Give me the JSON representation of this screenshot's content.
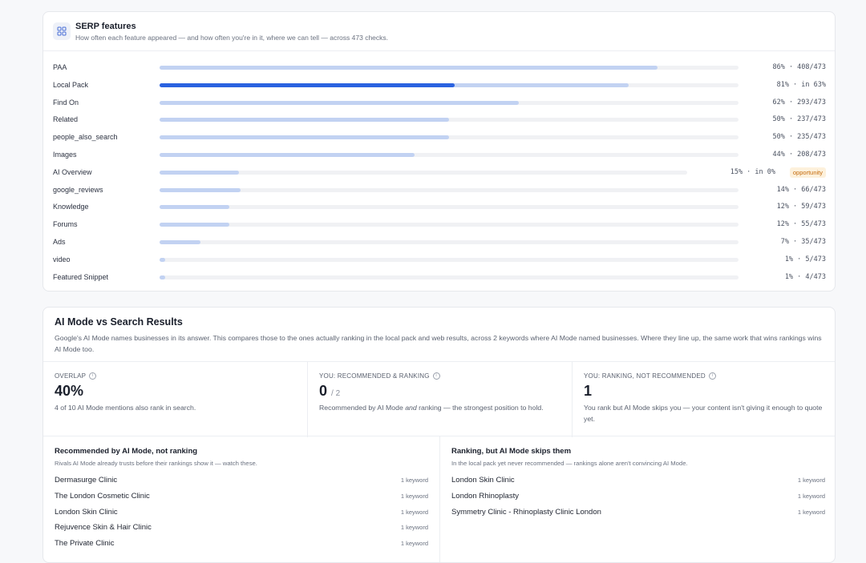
{
  "serp": {
    "title": "SERP features",
    "subtitle": "How often each feature appeared — and how often you're in it, where we can tell — across 473 checks.",
    "icon": "grid-icon",
    "rows": [
      {
        "label": "PAA",
        "pct": 86,
        "you_pct": null,
        "stat": "86% · 408/473",
        "badge": null
      },
      {
        "label": "Local Pack",
        "pct": 81,
        "you_pct": 63,
        "stat": "81% · in 63%",
        "badge": null
      },
      {
        "label": "Find On",
        "pct": 62,
        "you_pct": null,
        "stat": "62% · 293/473",
        "badge": null
      },
      {
        "label": "Related",
        "pct": 50,
        "you_pct": null,
        "stat": "50% · 237/473",
        "badge": null
      },
      {
        "label": "people_also_search",
        "pct": 50,
        "you_pct": null,
        "stat": "50% · 235/473",
        "badge": null
      },
      {
        "label": "Images",
        "pct": 44,
        "you_pct": null,
        "stat": "44% · 208/473",
        "badge": null
      },
      {
        "label": "AI Overview",
        "pct": 15,
        "you_pct": 0,
        "stat": "15% · in 0%",
        "badge": "opportunity"
      },
      {
        "label": "google_reviews",
        "pct": 14,
        "you_pct": null,
        "stat": "14% · 66/473",
        "badge": null
      },
      {
        "label": "Knowledge",
        "pct": 12,
        "you_pct": null,
        "stat": "12% · 59/473",
        "badge": null
      },
      {
        "label": "Forums",
        "pct": 12,
        "you_pct": null,
        "stat": "12% · 55/473",
        "badge": null
      },
      {
        "label": "Ads",
        "pct": 7,
        "you_pct": null,
        "stat": "7% · 35/473",
        "badge": null
      },
      {
        "label": "video",
        "pct": 1,
        "you_pct": null,
        "stat": "1% · 5/473",
        "badge": null
      },
      {
        "label": "Featured Snippet",
        "pct": 1,
        "you_pct": null,
        "stat": "1% · 4/473",
        "badge": null
      }
    ]
  },
  "ai_mode": {
    "title": "AI Mode vs Search Results",
    "description": "Google's AI Mode names businesses in its answer. This compares those to the ones actually ranking in the local pack and web results, across 2 keywords where AI Mode named businesses. Where they line up, the same work that wins rankings wins AI Mode too.",
    "stats": [
      {
        "label": "OVERLAP",
        "value": "40%",
        "of": "",
        "note": "4 of 10 AI Mode mentions also rank in search."
      },
      {
        "label": "YOU: RECOMMENDED & RANKING",
        "value": "0",
        "of": "/ 2",
        "note_pre": "Recommended by AI Mode ",
        "note_em": "and",
        "note_post": " ranking — the strongest position to hold."
      },
      {
        "label": "YOU: RANKING, NOT RECOMMENDED",
        "value": "1",
        "of": "",
        "note": "You rank but AI Mode skips you — your content isn't giving it enough to quote yet."
      }
    ],
    "left_list": {
      "title": "Recommended by AI Mode, not ranking",
      "subtitle": "Rivals AI Mode already trusts before their rankings show it — watch these.",
      "items": [
        {
          "name": "Dermasurge Clinic",
          "count": "1 keyword"
        },
        {
          "name": "The London Cosmetic Clinic",
          "count": "1 keyword"
        },
        {
          "name": "London Skin Clinic",
          "count": "1 keyword"
        },
        {
          "name": "Rejuvence Skin & Hair Clinic",
          "count": "1 keyword"
        },
        {
          "name": "The Private Clinic",
          "count": "1 keyword"
        }
      ]
    },
    "right_list": {
      "title": "Ranking, but AI Mode skips them",
      "subtitle": "In the local pack yet never recommended — rankings alone aren't convincing AI Mode.",
      "items": [
        {
          "name": "London Skin Clinic",
          "count": "1 keyword"
        },
        {
          "name": "London Rhinoplasty",
          "count": "1 keyword"
        },
        {
          "name": "Symmetry Clinic - Rhinoplasty Clinic London",
          "count": "1 keyword"
        }
      ]
    }
  },
  "colors": {
    "bar_light": "#c2d2f2",
    "bar_you": "#2a62e0",
    "badge_bg": "#fdf1dc",
    "badge_text": "#c46a0a"
  }
}
